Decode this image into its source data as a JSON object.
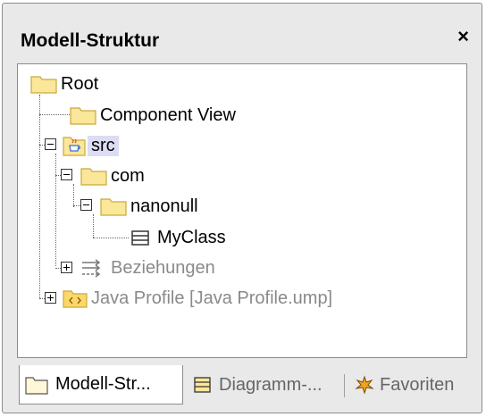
{
  "window": {
    "title": "Modell-Struktur",
    "close_glyph": "×"
  },
  "tree": {
    "root": "Root",
    "component_view": "Component View",
    "src": "src",
    "com": "com",
    "nanonull": "nanonull",
    "myclass": "MyClass",
    "beziehungen": "Beziehungen",
    "java_profile": "Java Profile [Java Profile.ump]"
  },
  "tabs": {
    "modell": "Modell-Str...",
    "diagramm": "Diagramm-...",
    "favoriten": "Favoriten"
  },
  "colors": {
    "folder_fill": "#fbe79a",
    "folder_stroke": "#c9a93a",
    "selection": "#dcdcf5",
    "gray_text": "#8a8a8a"
  }
}
